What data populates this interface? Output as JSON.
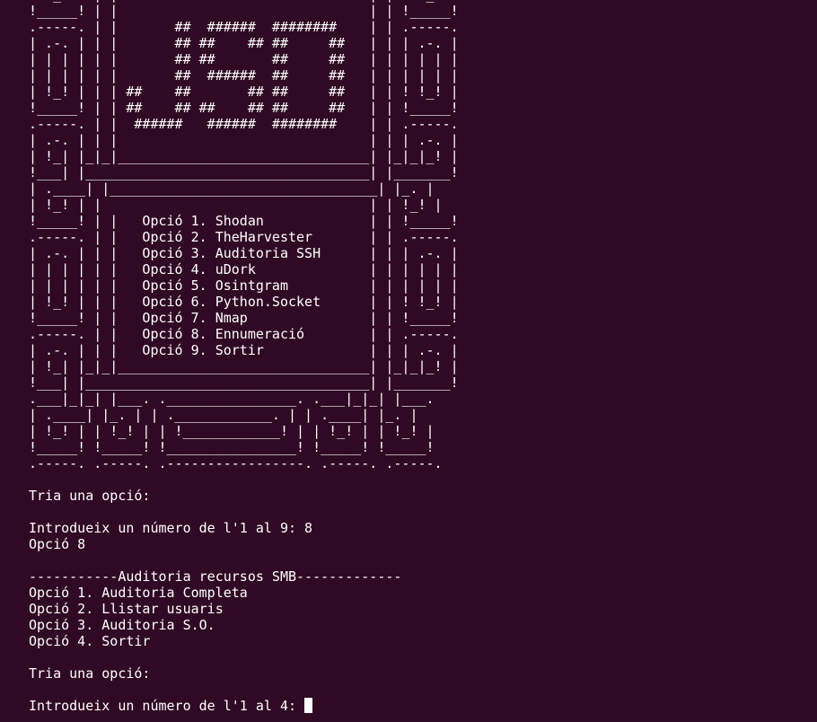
{
  "colors": {
    "background": "#300a24",
    "foreground": "#ffffff",
    "cursor": "#ffffff"
  },
  "banner_lines": [
    "! !_! ! | |                               | | ! !_! !",
    "!_____! | |                               | | !_____!",
    ".-----. | |       ##  ######  ########    | | .-----.",
    "| .-. | | |       ## ##    ## ##     ##   | | | .-. |",
    "| | | | | |       ## ##       ##     ##   | | | | | |",
    "| | | | | |       ##  ######  ##     ##   | | | | | |",
    "| !_! | | | ##    ##       ## ##     ##   | | ! !_! |",
    "!_____! | | ##    ## ##    ## ##     ##   | | !_____!",
    ".-----. | |  ######   ######  ########    | | .-----.",
    "| .-. | | |                               | | | .-. |",
    "| !_| |_|_|_______________________________| |_|_|_! |",
    "!___| |___________________________________| |_______!",
    "| .____| |_________________________________| |_. |",
    "| !_! | |                                 | | !_! |",
    "!_____! | |   Opció 1. Shodan             | | !_____!",
    ".-----. | |   Opció 2. TheHarvester       | | .-----.",
    "| .-. | | |   Opció 3. Auditoria SSH      | | | .-. |",
    "| | | | | |   Opció 4. uDork              | | | | | |",
    "| | | | | |   Opció 5. Osintgram          | | | | | |",
    "| !_! | | |   Opció 6. Python.Socket      | | ! !_! |",
    "!_____! | |   Opció 7. Nmap               | | !_____!",
    ".-----. | |   Opció 8. Ennumeració        | | .-----.",
    "| .-. | | |   Opció 9. Sortir             | | | .-. |",
    "| !_| |_|_|_______________________________| |_|_|_! |",
    "!___| |___________________________________| |_______!",
    ".___|_|_| |___. .________________. .___|_|_| |___.",
    "| .____| |_. | | .____________. | | .____| |_. |",
    "| !_! | | !_! | | !____________! | | !_! | | !_! |",
    "!_____! !_____! !________________! !_____! !_____!",
    ".-----. .-----. .-----------------. .-----. .-----."
  ],
  "output_lines": [
    "",
    "Tria una opció:",
    "",
    "Introdueix un número de l'1 al 9: 8",
    "Opció 8",
    "",
    "-----------Auditoria recursos SMB-------------",
    "Opció 1. Auditoria Completa",
    "Opció 2. Llistar usuaris",
    "Opció 3. Auditoria S.O.",
    "Opció 4. Sortir",
    "",
    "Tria una opció:",
    "",
    "Introdueix un número de l'1 al 4: "
  ]
}
